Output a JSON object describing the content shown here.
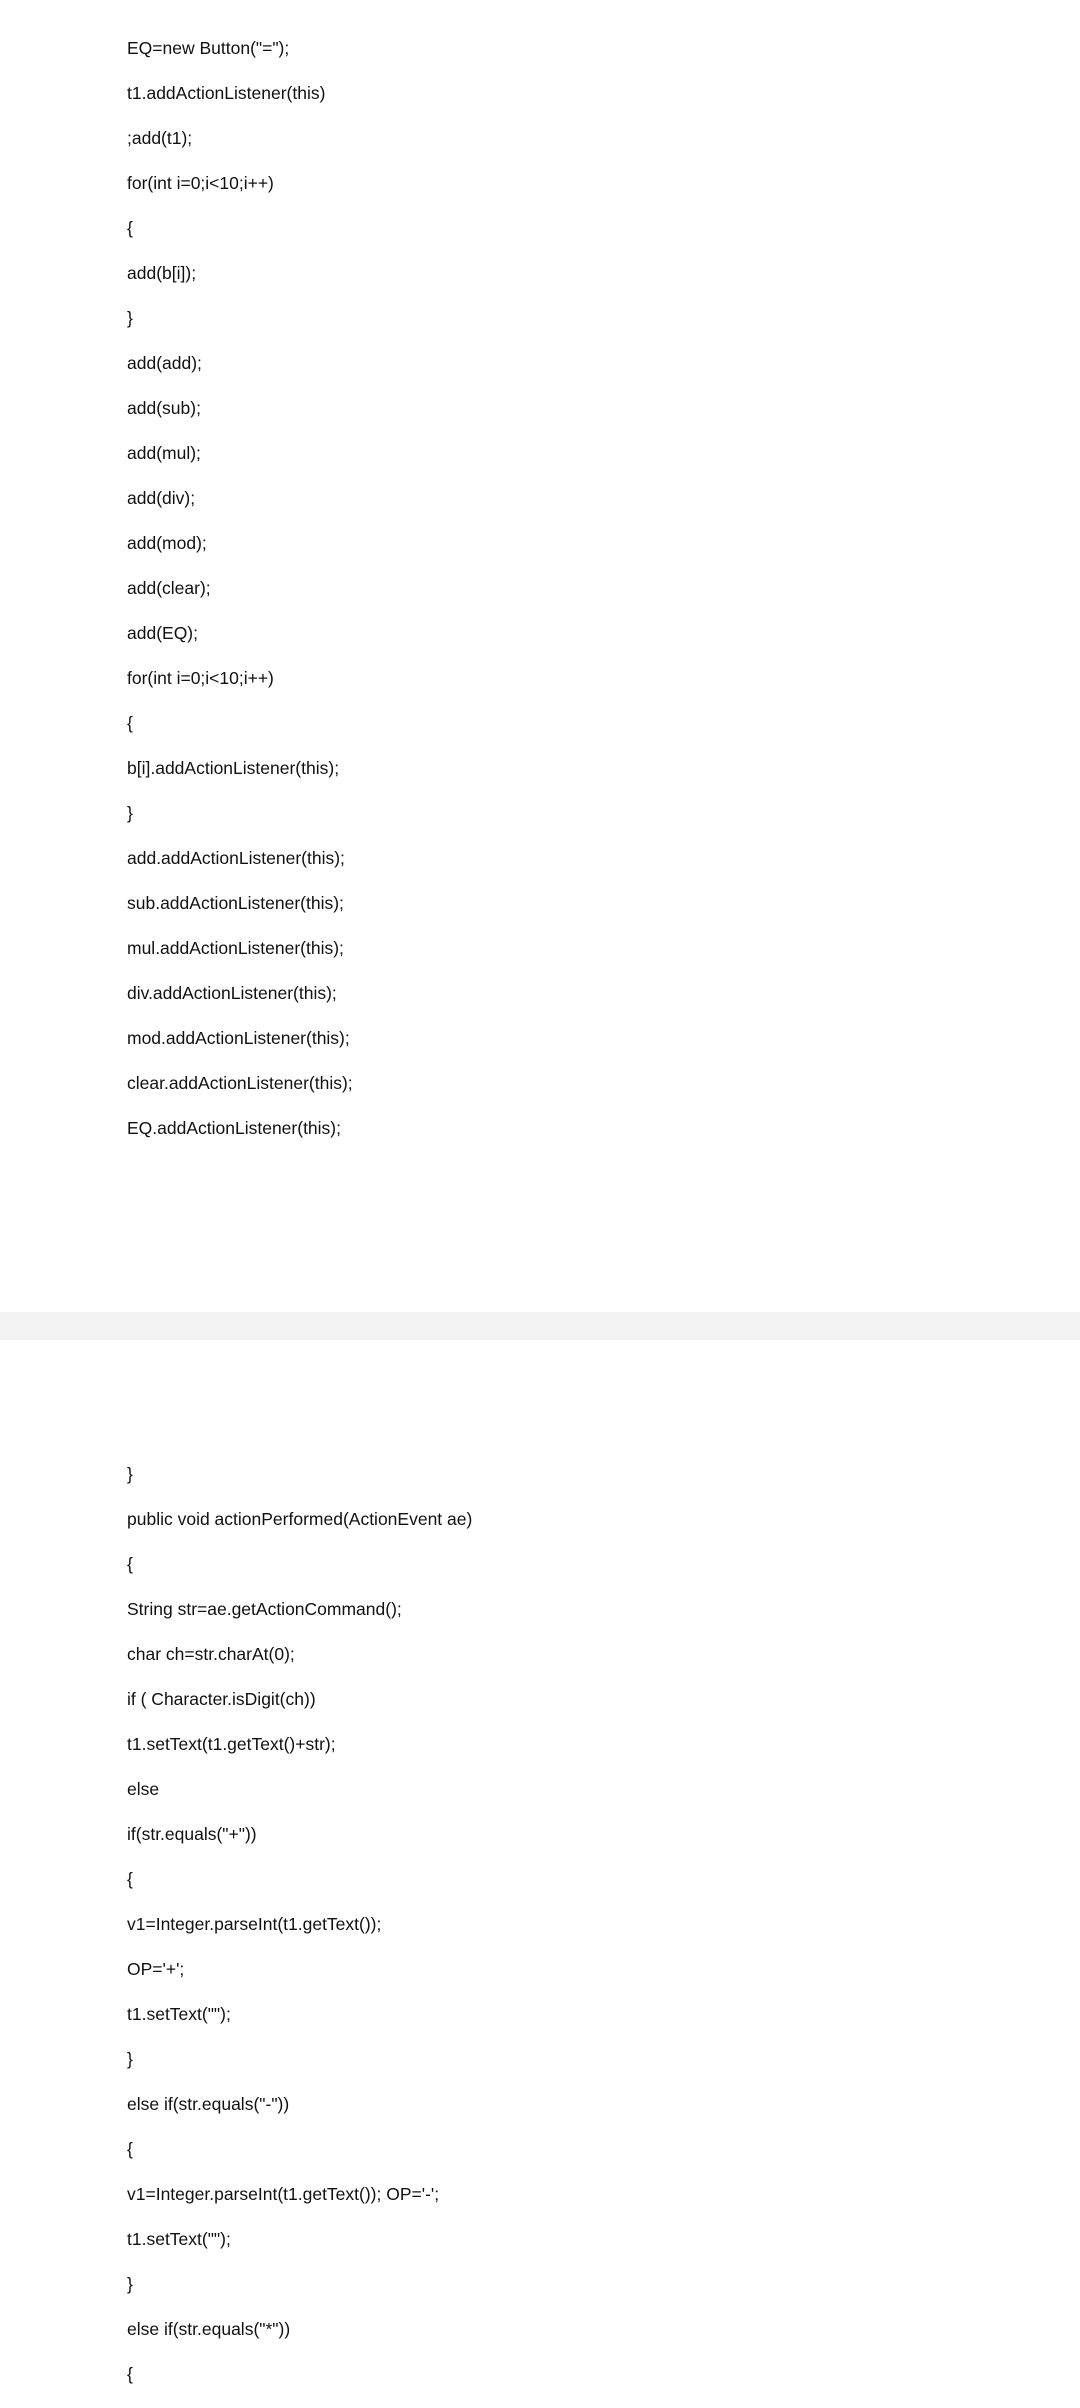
{
  "page1": {
    "lines": [
      "EQ=new Button(\"=\");",
      "t1.addActionListener(this)",
      ";add(t1);",
      "for(int i=0;i<10;i++)",
      "{",
      "add(b[i]);",
      "}",
      "add(add);",
      "add(sub);",
      "add(mul);",
      "add(div);",
      "add(mod);",
      "add(clear);",
      "add(EQ);",
      "for(int i=0;i<10;i++)",
      "{",
      "b[i].addActionListener(this);",
      "}",
      "add.addActionListener(this);",
      "sub.addActionListener(this);",
      "mul.addActionListener(this);",
      "div.addActionListener(this);",
      "mod.addActionListener(this);",
      "clear.addActionListener(this);",
      "EQ.addActionListener(this);"
    ]
  },
  "page2": {
    "lines": [
      "}",
      "public void actionPerformed(ActionEvent ae)",
      "{",
      "String str=ae.getActionCommand();",
      "char ch=str.charAt(0);",
      "if ( Character.isDigit(ch))",
      "t1.setText(t1.getText()+str);",
      "else",
      "if(str.equals(\"+\"))",
      "{",
      "v1=Integer.parseInt(t1.getText());",
      "OP='+';",
      "t1.setText(\"\");",
      "}",
      "else if(str.equals(\"-\"))",
      "{",
      "v1=Integer.parseInt(t1.getText()); OP='-';",
      "t1.setText(\"\");",
      "}",
      "else if(str.equals(\"*\"))",
      "{"
    ]
  }
}
